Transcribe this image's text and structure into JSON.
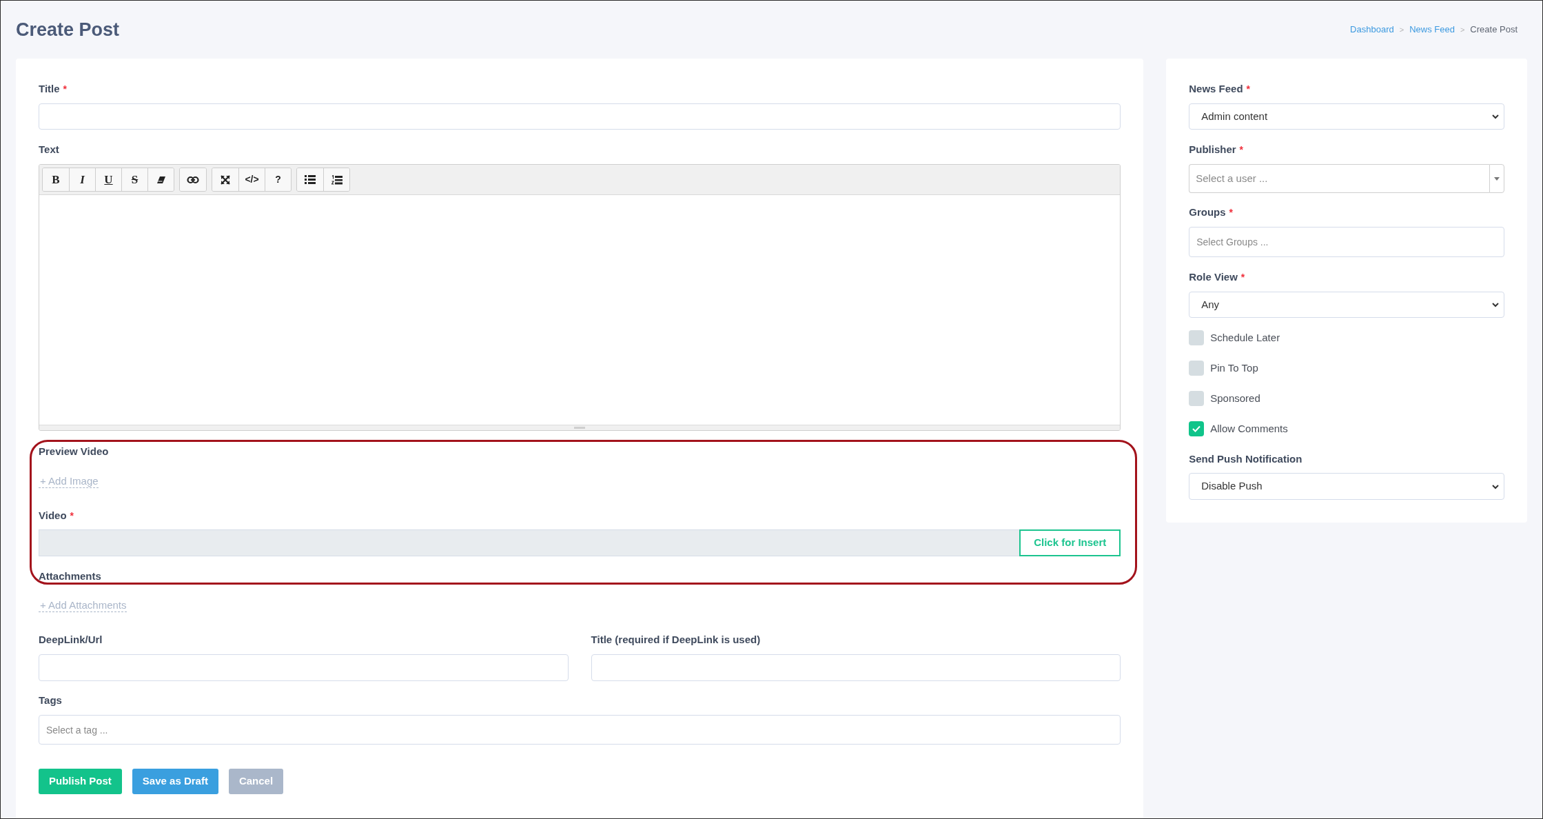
{
  "page_title": "Create Post",
  "breadcrumb": [
    {
      "label": "Dashboard",
      "current": false
    },
    {
      "label": "News Feed",
      "current": false
    },
    {
      "label": "Create Post",
      "current": true
    }
  ],
  "breadcrumb_separator": ">",
  "main_form": {
    "title_field": {
      "label": "Title",
      "required_mark": "*"
    },
    "text_editor": {
      "label": "Text",
      "toolbar": [
        [
          {
            "kind": "bold",
            "label": "B"
          },
          {
            "kind": "italic",
            "label": "I"
          },
          {
            "kind": "underline",
            "label": "U"
          },
          {
            "kind": "strike",
            "label": "S"
          },
          {
            "kind": "eraser"
          }
        ],
        [
          {
            "kind": "link"
          }
        ],
        [
          {
            "kind": "expand"
          },
          {
            "kind": "glyph",
            "label": "</>"
          },
          {
            "kind": "glyph",
            "label": "?"
          }
        ],
        [
          {
            "kind": "bullets"
          },
          {
            "kind": "numbers"
          }
        ]
      ]
    },
    "preview_video": {
      "label": "Preview Video",
      "add_link": "+ Add Image"
    },
    "video": {
      "label": "Video",
      "required_mark": "*",
      "insert_button": "Click for Insert"
    },
    "attachments": {
      "label": "Attachments",
      "add_link": "+ Add Attachments"
    },
    "deeplink": {
      "label": "DeepLink/Url"
    },
    "deeplink_title": {
      "label": "Title (required if DeepLink is used)"
    },
    "tags": {
      "label": "Tags",
      "placeholder": "Select a tag ..."
    },
    "buttons": [
      {
        "label": "Publish Post",
        "kind": "primary"
      },
      {
        "label": "Save as Draft",
        "kind": "secondary"
      },
      {
        "label": "Cancel",
        "kind": "muted"
      }
    ]
  },
  "side_form": {
    "news_feed": {
      "label": "News Feed",
      "required_mark": "*",
      "value": "Admin content"
    },
    "publisher": {
      "label": "Publisher",
      "required_mark": "*",
      "placeholder": "Select a user ..."
    },
    "groups": {
      "label": "Groups",
      "required_mark": "*",
      "placeholder": "Select Groups ..."
    },
    "role_view": {
      "label": "Role View",
      "required_mark": "*",
      "value": "Any"
    },
    "options": [
      {
        "label": "Schedule Later",
        "checked": false
      },
      {
        "label": "Pin To Top",
        "checked": false
      },
      {
        "label": "Sponsored",
        "checked": false
      },
      {
        "label": "Allow Comments",
        "checked": true
      }
    ],
    "push": {
      "label": "Send Push Notification",
      "value": "Disable Push"
    }
  }
}
